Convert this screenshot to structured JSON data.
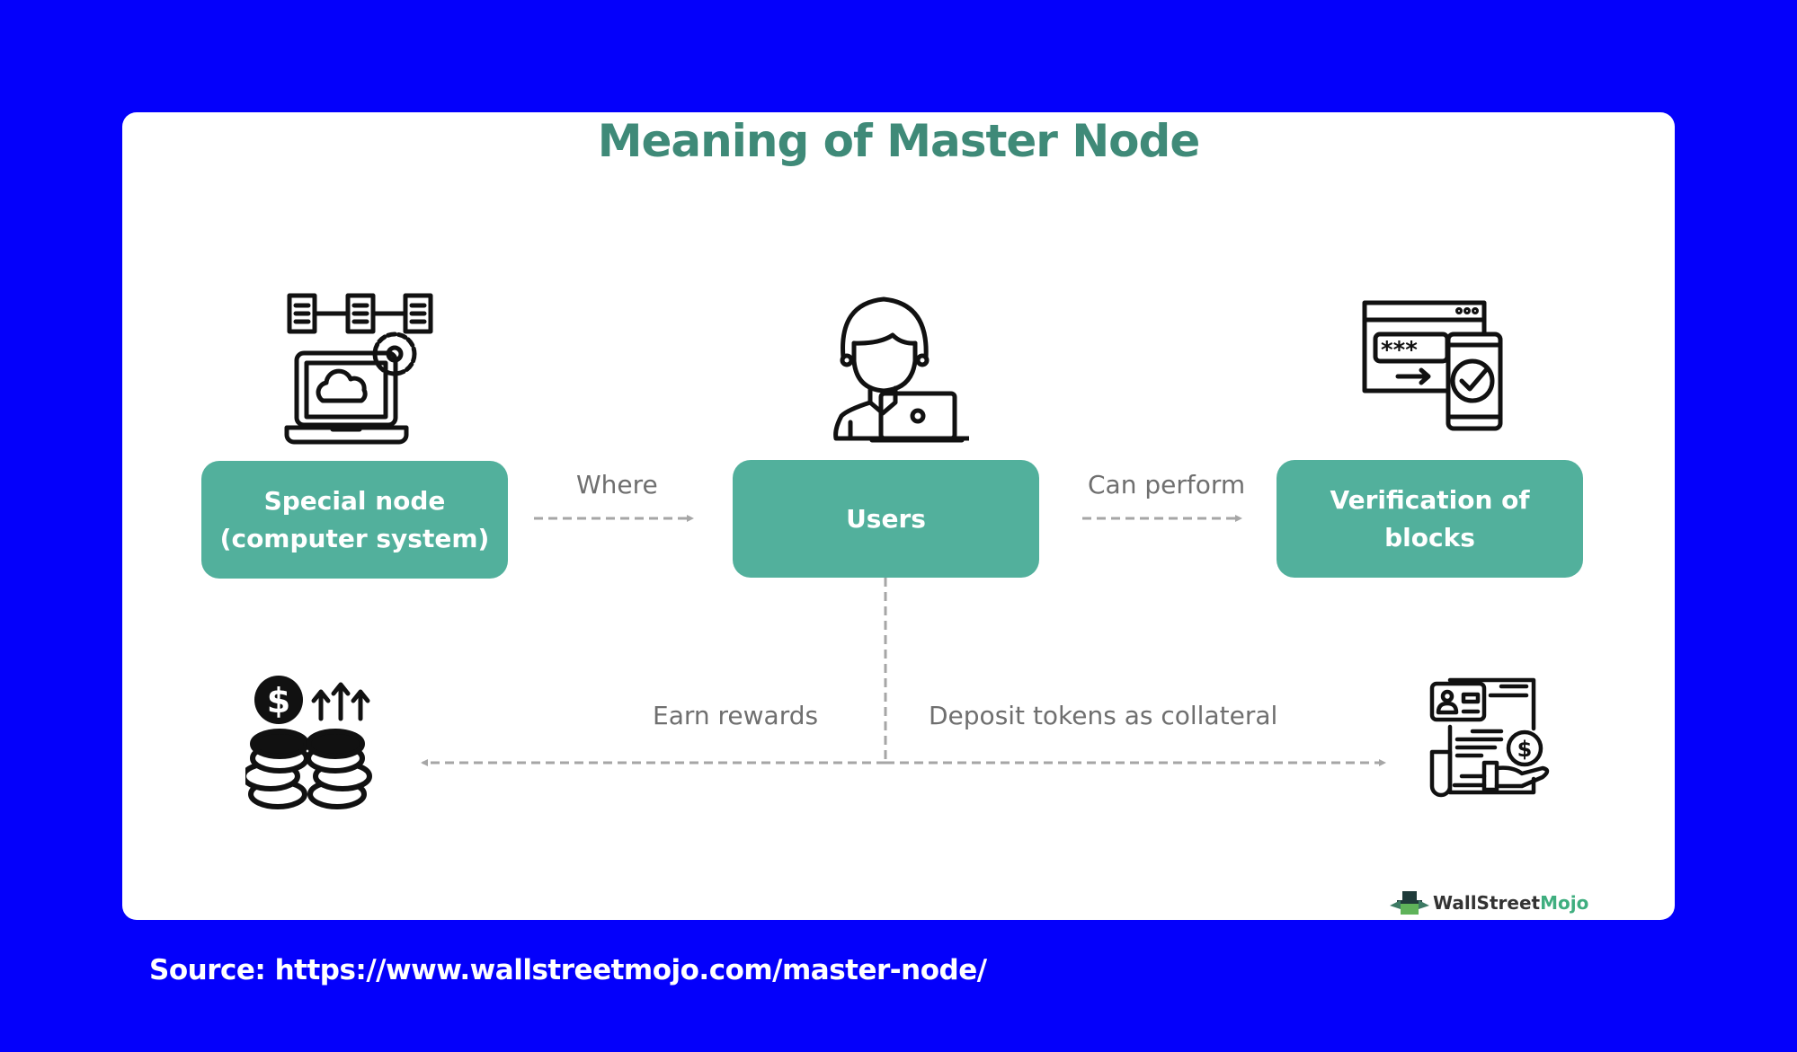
{
  "diagram": {
    "title": "Meaning of Master Node",
    "nodes": [
      {
        "id": "special-node",
        "label_line1": "Special node",
        "label_line2": "(computer system)",
        "icon": "laptop-cloud-servers-gear-icon"
      },
      {
        "id": "users",
        "label": "Users",
        "icon": "user-laptop-icon"
      },
      {
        "id": "verification",
        "label_line1": "Verification of",
        "label_line2": "blocks",
        "icon": "password-mobile-verified-icon"
      }
    ],
    "edges": [
      {
        "from": "special-node",
        "to": "users",
        "label": "Where"
      },
      {
        "from": "users",
        "to": "verification",
        "label": "Can perform"
      },
      {
        "from": "users",
        "to": "earn-rewards",
        "label": "Earn rewards"
      },
      {
        "from": "users",
        "to": "deposit-collateral",
        "label": "Deposit tokens as collateral"
      }
    ],
    "bottom_icons": [
      {
        "id": "earn-rewards",
        "icon": "coins-dollar-arrows-up-icon"
      },
      {
        "id": "deposit-collateral",
        "icon": "document-dollar-hand-icon"
      }
    ],
    "colors": {
      "box": "#52b09c",
      "title": "#3f8a78",
      "connector": "#a6a6a6",
      "background": "#0400fb"
    }
  },
  "watermark": {
    "part1": "WallStreet",
    "part2": "Mojo"
  },
  "source": "Source: https://www.wallstreetmojo.com/master-node/"
}
